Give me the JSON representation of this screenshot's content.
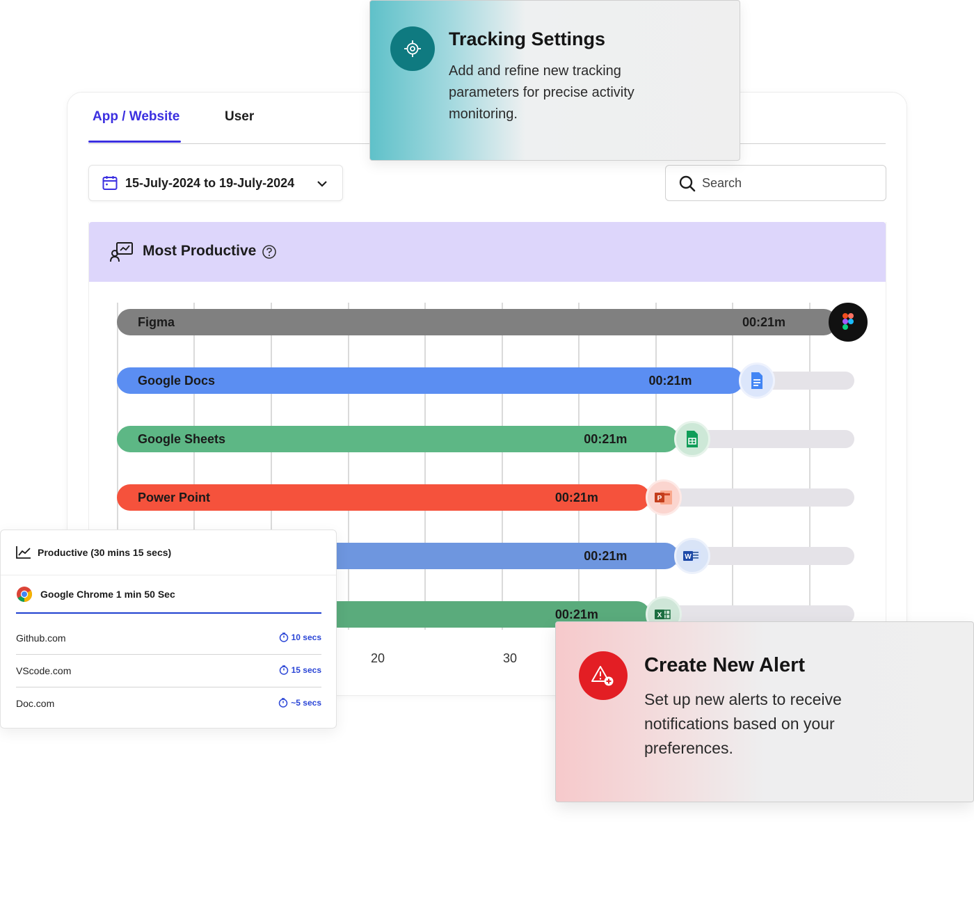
{
  "tabs": {
    "app_website": "App / Website",
    "user": "User"
  },
  "date_range": {
    "label": "15-July-2024 to 19-July-2024"
  },
  "search": {
    "placeholder": "Search"
  },
  "most_productive": {
    "title": "Most Productive"
  },
  "chart_data": {
    "type": "bar",
    "orientation": "horizontal",
    "title": "Most Productive",
    "categories": [
      "Figma",
      "Google Docs",
      "Google Sheets",
      "Power Point",
      "",
      ""
    ],
    "values": [
      1.0,
      0.87,
      0.78,
      0.74,
      0.78,
      0.74
    ],
    "value_labels": [
      "00:21m",
      "00:21m",
      "00:21m",
      "00:21m",
      "00:21m",
      "00:21m"
    ],
    "x_ticks": [
      "20",
      "30"
    ],
    "grid": true,
    "colors": [
      "#808080",
      "#5b8ef2",
      "#5db785",
      "#f5523c",
      "#6e96df",
      "#5aab7c"
    ]
  },
  "tracking_card": {
    "title": "Tracking Settings",
    "description": "Add and refine new tracking parameters for precise activity monitoring."
  },
  "productive_popover": {
    "title": "Productive (30 mins 15 secs)",
    "top_app": "Google Chrome 1 min 50 Sec",
    "sites": [
      {
        "name": "Github.com",
        "time": "10 secs"
      },
      {
        "name": "VScode.com",
        "time": "15 secs"
      },
      {
        "name": "Doc.com",
        "time": "~5 secs"
      }
    ]
  },
  "alert_card": {
    "title": "Create New Alert",
    "description": "Set up new alerts to receive notifications based on your preferences."
  },
  "colors": {
    "accent": "#3b2fe0",
    "teal": "#0f7a80",
    "alert_red": "#e31e24",
    "header_lavender": "#ddd6fb"
  }
}
